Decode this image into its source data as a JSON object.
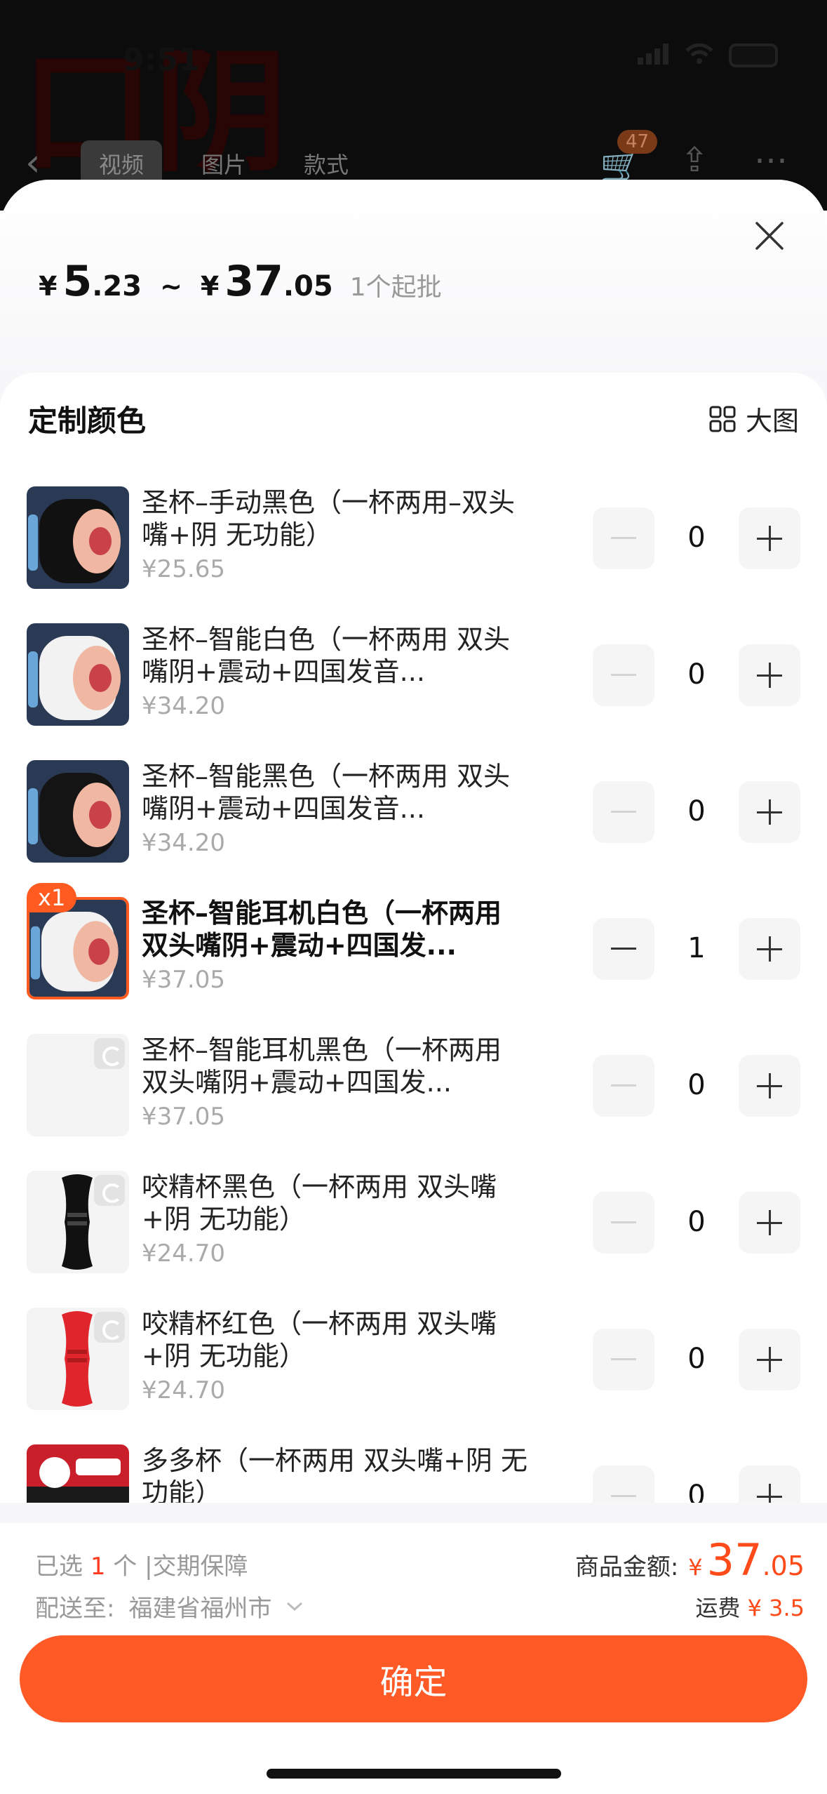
{
  "background": {
    "status_time": "9:51",
    "big_text": "口阴",
    "tabs": [
      "视频",
      "图片",
      "款式"
    ],
    "cart_badge": "47"
  },
  "sheet": {
    "price": {
      "currency": "¥",
      "low_int": "5",
      "low_dec": ".23",
      "tilde": "~",
      "high_int": "37",
      "high_dec": ".05",
      "moq": "1个起批"
    },
    "section_title": "定制颜色",
    "big_pic_label": "大图",
    "items": [
      {
        "name": "圣杯–手动黑色（一杯两用–双头嘴+阴 无功能）",
        "price": "¥25.65",
        "qty": "0",
        "selected": false
      },
      {
        "name": "圣杯–智能白色（一杯两用 双头嘴阴+震动+四国发音...",
        "price": "¥34.20",
        "qty": "0",
        "selected": false
      },
      {
        "name": "圣杯–智能黑色（一杯两用 双头嘴阴+震动+四国发音...",
        "price": "¥34.20",
        "qty": "0",
        "selected": false
      },
      {
        "name": "圣杯–智能耳机白色（一杯两用 双头嘴阴+震动+四国发...",
        "price": "¥37.05",
        "qty": "1",
        "selected": true,
        "badge": "x1"
      },
      {
        "name": "圣杯–智能耳机黑色（一杯两用 双头嘴阴+震动+四国发...",
        "price": "¥37.05",
        "qty": "0",
        "selected": false
      },
      {
        "name": "咬精杯黑色（一杯两用 双头嘴+阴 无功能）",
        "price": "¥24.70",
        "qty": "0",
        "selected": false
      },
      {
        "name": "咬精杯红色（一杯两用 双头嘴+阴 无功能）",
        "price": "¥24.70",
        "qty": "0",
        "selected": false
      },
      {
        "name": "多多杯（一杯两用 双头嘴+阴 无功能）",
        "price": "",
        "qty": "0",
        "selected": false
      }
    ]
  },
  "bottom": {
    "selected_prefix": "已选",
    "selected_count": "1",
    "selected_suffix": "个 |交期保障",
    "ship_label": "配送至:",
    "ship_address": "福建省福州市",
    "amount_label": "商品金额:",
    "amount_currency": "¥",
    "amount_int": "37",
    "amount_dec": ".05",
    "freight_label": "运费",
    "freight_value": "¥ 3.5",
    "confirm_label": "确定"
  },
  "colors": {
    "accent": "#ff5a26",
    "price_red": "#ff4a1a"
  }
}
